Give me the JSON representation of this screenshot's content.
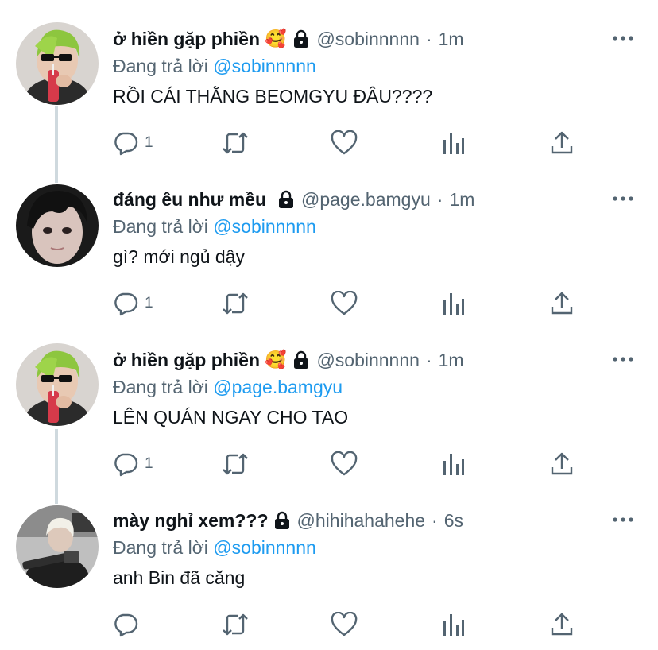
{
  "icons": {
    "reply": "reply-icon",
    "retweet": "retweet-icon",
    "like": "heart-icon",
    "analytics": "analytics-icon",
    "share": "share-icon",
    "lock": "lock-icon",
    "more": "more-icon"
  },
  "colors": {
    "text": "#0f1419",
    "secondary": "#536471",
    "mention": "#1d9bf0",
    "thread_line": "#cfd9de"
  },
  "replying_prefix": "Đang trả lời",
  "tweets": [
    {
      "display_name": "ở hiền gặp phiền",
      "emoji": "🥰",
      "handle": "@sobinnnnn",
      "separator": "·",
      "time": "1m",
      "reply_to": "@sobinnnnn",
      "text": "RỒI CÁI THẰNG BEOMGYU ĐÂU????",
      "reply_count": "1"
    },
    {
      "display_name": "đáng êu như mều",
      "emoji": "",
      "handle": "@page.bamgyu",
      "separator": "·",
      "time": "1m",
      "reply_to": "@sobinnnnn",
      "text": "gì? mới ngủ dậy",
      "reply_count": "1"
    },
    {
      "display_name": "ở hiền gặp phiền",
      "emoji": "🥰",
      "handle": "@sobinnnnn",
      "separator": "·",
      "time": "1m",
      "reply_to": "@page.bamgyu",
      "text": "LÊN QUÁN NGAY CHO TAO",
      "reply_count": "1"
    },
    {
      "display_name": "mày nghỉ xem???",
      "emoji": "",
      "handle": "@hihihahahehe",
      "separator": "·",
      "time": "6s",
      "reply_to": "@sobinnnnn",
      "text": "anh Bin đã căng",
      "reply_count": ""
    }
  ]
}
